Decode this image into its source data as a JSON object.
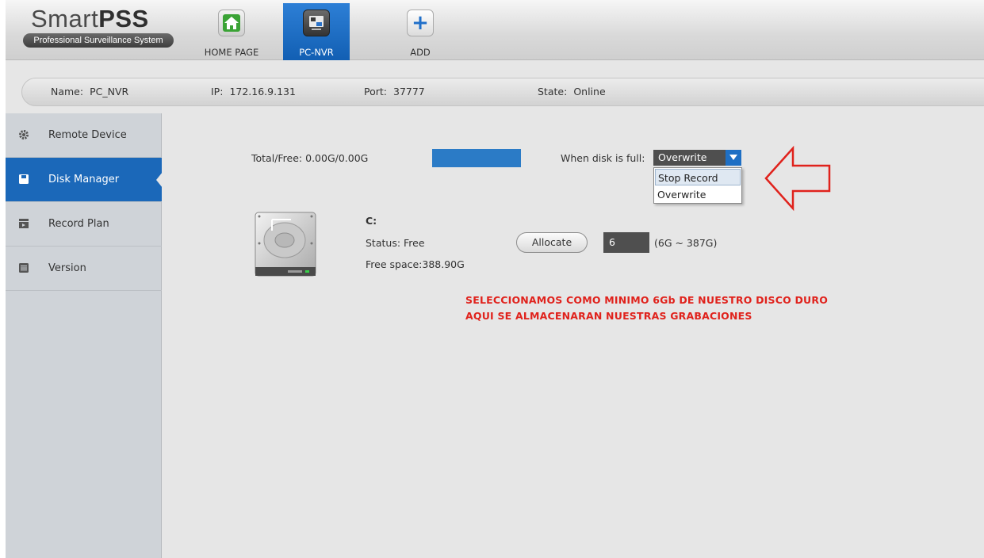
{
  "app": {
    "logo_main": "Smart",
    "logo_bold": "PSS",
    "logo_sub": "Professional Surveillance System"
  },
  "nav": {
    "home_label": "HOME PAGE",
    "pcnvr_label": "PC-NVR",
    "add_label": "ADD"
  },
  "device": {
    "name_label": "Name:",
    "name_value": "PC_NVR",
    "ip_label": "IP:",
    "ip_value": "172.16.9.131",
    "port_label": "Port:",
    "port_value": "37777",
    "state_label": "State:",
    "state_value": "Online"
  },
  "sidebar": {
    "items": [
      {
        "label": "Remote Device",
        "icon": "gear-icon"
      },
      {
        "label": "Disk Manager",
        "icon": "floppy-icon",
        "active": true
      },
      {
        "label": "Record Plan",
        "icon": "clapper-icon"
      },
      {
        "label": "Version",
        "icon": "list-icon"
      }
    ]
  },
  "disk": {
    "total_free": "Total/Free: 0.00G/0.00G",
    "when_full_label": "When disk is full:",
    "when_full_value": "Overwrite",
    "options": [
      "Stop Record",
      "Overwrite"
    ],
    "highlighted_option": "Stop Record",
    "drive_letter": "C:",
    "status": "Status: Free",
    "free_space": "Free space:388.90G",
    "allocate_label": "Allocate",
    "allocate_value": "6",
    "allocate_range": "(6G ~ 387G)"
  },
  "annotation": {
    "line1": "SELECCIONAMOS COMO MINIMO 6Gb DE NUESTRO DISCO DURO",
    "line2": "AQUI SE ALMACENARAN NUESTRAS GRABACIONES"
  },
  "colors": {
    "accent": "#1b68b9",
    "annotation": "#e0221c",
    "capacity_bar": "#2b7bc6"
  }
}
